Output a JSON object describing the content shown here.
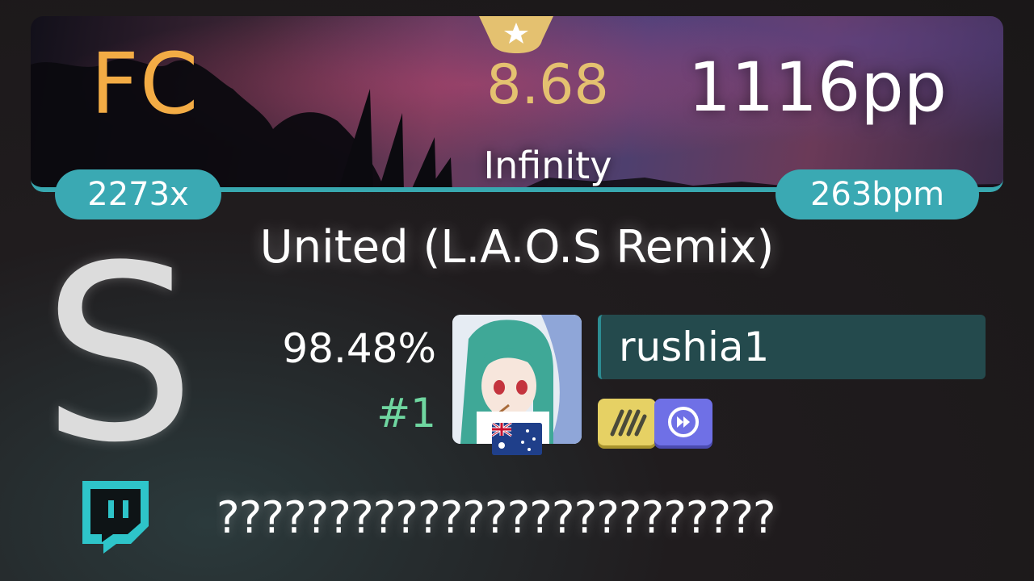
{
  "banner": {
    "full_combo_label": "FC",
    "star_rating": "8.68",
    "difficulty_name": "Infinity",
    "pp": "1116pp",
    "max_combo": "2273x",
    "bpm": "263bpm"
  },
  "song": {
    "title": "United (L.A.O.S Remix)"
  },
  "score": {
    "rank": "S",
    "accuracy": "98.48%",
    "position": "#1"
  },
  "player": {
    "username": "rushia1",
    "country": "australia-flag",
    "mods": [
      "hidden-mod-icon",
      "double-time-mod-icon"
    ]
  },
  "comment": {
    "text": "?????????????????????????"
  },
  "colors": {
    "accent_teal": "#3aa9b3",
    "fc_orange": "#f3ac45",
    "star_gold": "#e4c170",
    "rank_position_green": "#6fd6a0",
    "username_box": "#244a4d",
    "mod_hidden": "#e6d164",
    "mod_double_time": "#6f70e6"
  }
}
